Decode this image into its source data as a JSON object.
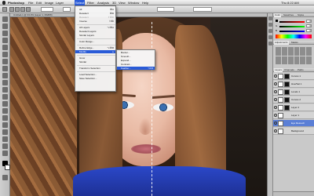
{
  "menubar": {
    "app": "Photoshop",
    "items": [
      "File",
      "Edit",
      "Image",
      "Layer",
      "Select",
      "Filter",
      "Analysis",
      "3D",
      "View",
      "Window",
      "Help"
    ],
    "active": "Select",
    "status": "Thu 8:22 AM"
  },
  "document": {
    "title": "Untitled-1 @ 33.3% (Layer 1, RGB/8)"
  },
  "select_menu": {
    "items": [
      {
        "label": "All",
        "shortcut": "⌘A",
        "disabled": false
      },
      {
        "label": "Deselect",
        "shortcut": "⌘D",
        "disabled": false
      },
      {
        "label": "Reselect",
        "shortcut": "⇧⌘D",
        "disabled": true
      },
      {
        "label": "Inverse",
        "shortcut": "⇧⌘I",
        "disabled": false
      },
      {
        "sep": true
      },
      {
        "label": "All Layers",
        "shortcut": "⌥⌘A",
        "disabled": false
      },
      {
        "label": "Deselect Layers",
        "shortcut": "",
        "disabled": false
      },
      {
        "label": "Similar Layers",
        "shortcut": "",
        "disabled": false
      },
      {
        "sep": true
      },
      {
        "label": "Color Range...",
        "shortcut": "",
        "disabled": false
      },
      {
        "sep": true
      },
      {
        "label": "Refine Edge...",
        "shortcut": "⌥⌘R",
        "disabled": false
      },
      {
        "label": "Modify",
        "shortcut": "▸",
        "disabled": false,
        "highlighted": true
      },
      {
        "sep": true
      },
      {
        "label": "Grow",
        "shortcut": "",
        "disabled": false
      },
      {
        "label": "Similar",
        "shortcut": "",
        "disabled": false
      },
      {
        "sep": true
      },
      {
        "label": "Transform Selection",
        "shortcut": "",
        "disabled": false
      },
      {
        "sep": true
      },
      {
        "label": "Load Selection...",
        "shortcut": "",
        "disabled": false
      },
      {
        "label": "Save Selection...",
        "shortcut": "",
        "disabled": false
      }
    ]
  },
  "modify_menu": {
    "items": [
      {
        "label": "Border...",
        "shortcut": "",
        "highlighted": false
      },
      {
        "label": "Smooth...",
        "shortcut": "",
        "highlighted": false
      },
      {
        "label": "Expand...",
        "shortcut": "",
        "highlighted": false
      },
      {
        "label": "Contract...",
        "shortcut": "",
        "highlighted": false
      },
      {
        "label": "Feather...",
        "shortcut": "⌥F6",
        "highlighted": true
      }
    ]
  },
  "panels": {
    "color_tabs": [
      "Color",
      "Swatches",
      "Styles"
    ],
    "sliders": [
      {
        "label": "R",
        "value": "0"
      },
      {
        "label": "G",
        "value": "0"
      },
      {
        "label": "B",
        "value": "0"
      }
    ],
    "adjust_tabs": [
      "Adjustments",
      "Masks"
    ],
    "layer_tabs": [
      "Layers",
      "Channels",
      "Paths"
    ],
    "layers": [
      {
        "name": "Curves 1",
        "selected": false
      },
      {
        "name": "Hue/Sat 1",
        "selected": false
      },
      {
        "name": "Levels 1",
        "selected": false
      },
      {
        "name": "Curves 2",
        "selected": false
      },
      {
        "name": "Layer 2",
        "selected": false
      },
      {
        "name": "Layer 1",
        "selected": false
      },
      {
        "name": "Eye Retouch",
        "selected": true
      },
      {
        "name": "Background",
        "selected": false
      }
    ]
  },
  "colors": {
    "menu_highlight": "#2a5bd7",
    "layer_selected": "#5b7fd6"
  }
}
